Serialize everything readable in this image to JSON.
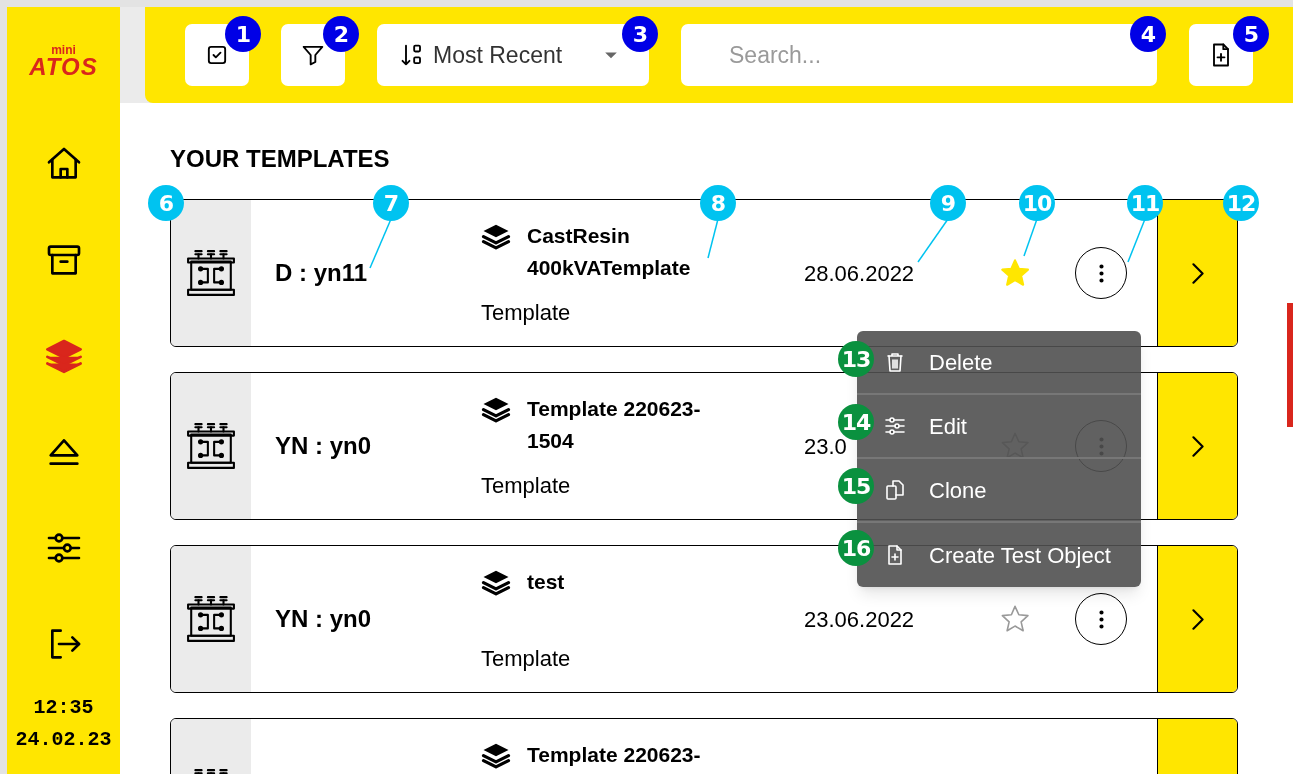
{
  "sidebar": {
    "logo": {
      "top": "mini",
      "bottom": "ATOS"
    },
    "items": [
      {
        "kind": "home",
        "selected": false
      },
      {
        "kind": "archive",
        "selected": false
      },
      {
        "kind": "layers",
        "selected": true
      },
      {
        "kind": "eject",
        "selected": false
      },
      {
        "kind": "sliders",
        "selected": false
      },
      {
        "kind": "logout",
        "selected": false
      }
    ],
    "time": "12:35",
    "date": "24.02.23"
  },
  "toolbar": {
    "sort": {
      "label": "Most Recent"
    },
    "search": {
      "placeholder": "Search..."
    }
  },
  "section_title": "YOUR TEMPLATES",
  "templates": [
    {
      "connection": "D : yn11",
      "name": "CastResin 400kVATemplate",
      "type": "Template",
      "date": "28.06.2022",
      "favorite": true
    },
    {
      "connection": "YN : yn0",
      "name": "Template 220623-1504",
      "type": "Template",
      "date": "23.0",
      "favorite": false
    },
    {
      "connection": "YN : yn0",
      "name": "test",
      "type": "Template",
      "date": "23.06.2022",
      "favorite": false
    },
    {
      "name": "Template 220623-"
    }
  ],
  "context_menu": [
    {
      "kind": "delete",
      "label": "Delete"
    },
    {
      "kind": "edit",
      "label": "Edit"
    },
    {
      "kind": "clone",
      "label": "Clone"
    },
    {
      "kind": "create",
      "label": "Create Test Object"
    }
  ],
  "callouts": [
    {
      "label": "1",
      "color": "#0000e6"
    },
    {
      "label": "2",
      "color": "#0000e6"
    },
    {
      "label": "3",
      "color": "#0000e6"
    },
    {
      "label": "4",
      "color": "#0000e6"
    },
    {
      "label": "5",
      "color": "#0000e6"
    },
    {
      "label": "6",
      "color": "#00c3f0"
    },
    {
      "label": "7",
      "color": "#00c3f0"
    },
    {
      "label": "8",
      "color": "#00c3f0"
    },
    {
      "label": "9",
      "color": "#00c3f0"
    },
    {
      "label": "10",
      "color": "#00c3f0"
    },
    {
      "label": "11",
      "color": "#00c3f0"
    },
    {
      "label": "12",
      "color": "#00c3f0"
    },
    {
      "label": "13",
      "color": "#0a913f"
    },
    {
      "label": "14",
      "color": "#0a913f"
    },
    {
      "label": "15",
      "color": "#0a913f"
    },
    {
      "label": "16",
      "color": "#0a913f"
    }
  ]
}
